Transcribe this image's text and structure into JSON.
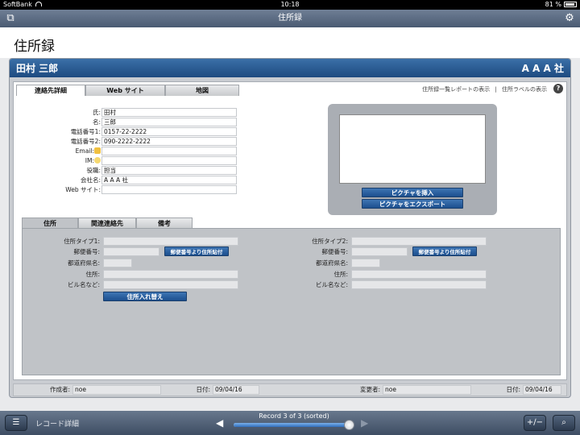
{
  "status": {
    "carrier": "SoftBank",
    "time": "10:18",
    "battery": "81 %"
  },
  "navbar": {
    "title": "住所録",
    "left_icon": "windows-icon",
    "right_icon": "gear-icon"
  },
  "page": {
    "title": "住所録"
  },
  "record": {
    "name": "田村 三郎",
    "company_header": "A A A 社"
  },
  "tabs": [
    {
      "label": "連絡先詳細",
      "active": true
    },
    {
      "label": "Web サイト",
      "active": false
    },
    {
      "label": "地図",
      "active": false
    }
  ],
  "top_links": {
    "report": "住所録一覧レポートの表示",
    "separator": "|",
    "label_link": "住所ラベルの表示",
    "help": "?"
  },
  "fields": [
    {
      "label": "氏:",
      "value": "田村"
    },
    {
      "label": "名:",
      "value": "三郎"
    },
    {
      "label": "電話番号1:",
      "value": "0157-22-2222"
    },
    {
      "label": "電話番号2:",
      "value": "090-2222-2222"
    },
    {
      "label": "Email:",
      "value": ""
    },
    {
      "label": "IM:",
      "value": ""
    },
    {
      "label": "役職:",
      "value": "担当"
    },
    {
      "label": "会社名:",
      "value": "A A A 社"
    },
    {
      "label": "Web サイト:",
      "value": ""
    }
  ],
  "picture_buttons": {
    "insert": "ピクチャを挿入",
    "export": "ピクチャをエクスポート"
  },
  "address_tabs": [
    {
      "label": "住所",
      "active": true
    },
    {
      "label": "関連連絡先",
      "active": false
    },
    {
      "label": "備考",
      "active": false
    }
  ],
  "address": {
    "left": {
      "type_label": "住所タイプ1:",
      "postal_label": "郵便番号:",
      "postal_button": "郵便番号より住所貼付",
      "pref_label": "都道府県名:",
      "addr_label": "住所:",
      "bldg_label": "ビル名など:"
    },
    "right": {
      "type_label": "住所タイプ2:",
      "postal_label": "郵便番号:",
      "postal_button": "郵便番号より住所貼付",
      "pref_label": "都道府県名:",
      "addr_label": "住所:",
      "bldg_label": "ビル名など:"
    },
    "swap_button": "住所入れ替え"
  },
  "meta": {
    "creator_label": "作成者:",
    "creator": "noe",
    "created_date_label": "日付:",
    "created_date": "09/04/16",
    "modifier_label": "変更者:",
    "modifier": "noe",
    "modified_date_label": "日付:",
    "modified_date": "09/04/16"
  },
  "toolbar": {
    "view_label": "レコード詳細",
    "record_text": "Record 3 of 3 (sorted)",
    "record_position": 1.0
  },
  "colors": {
    "header_blue": "#1d4a80",
    "button_blue": "#2c5f9e",
    "nav": "#56667e"
  }
}
